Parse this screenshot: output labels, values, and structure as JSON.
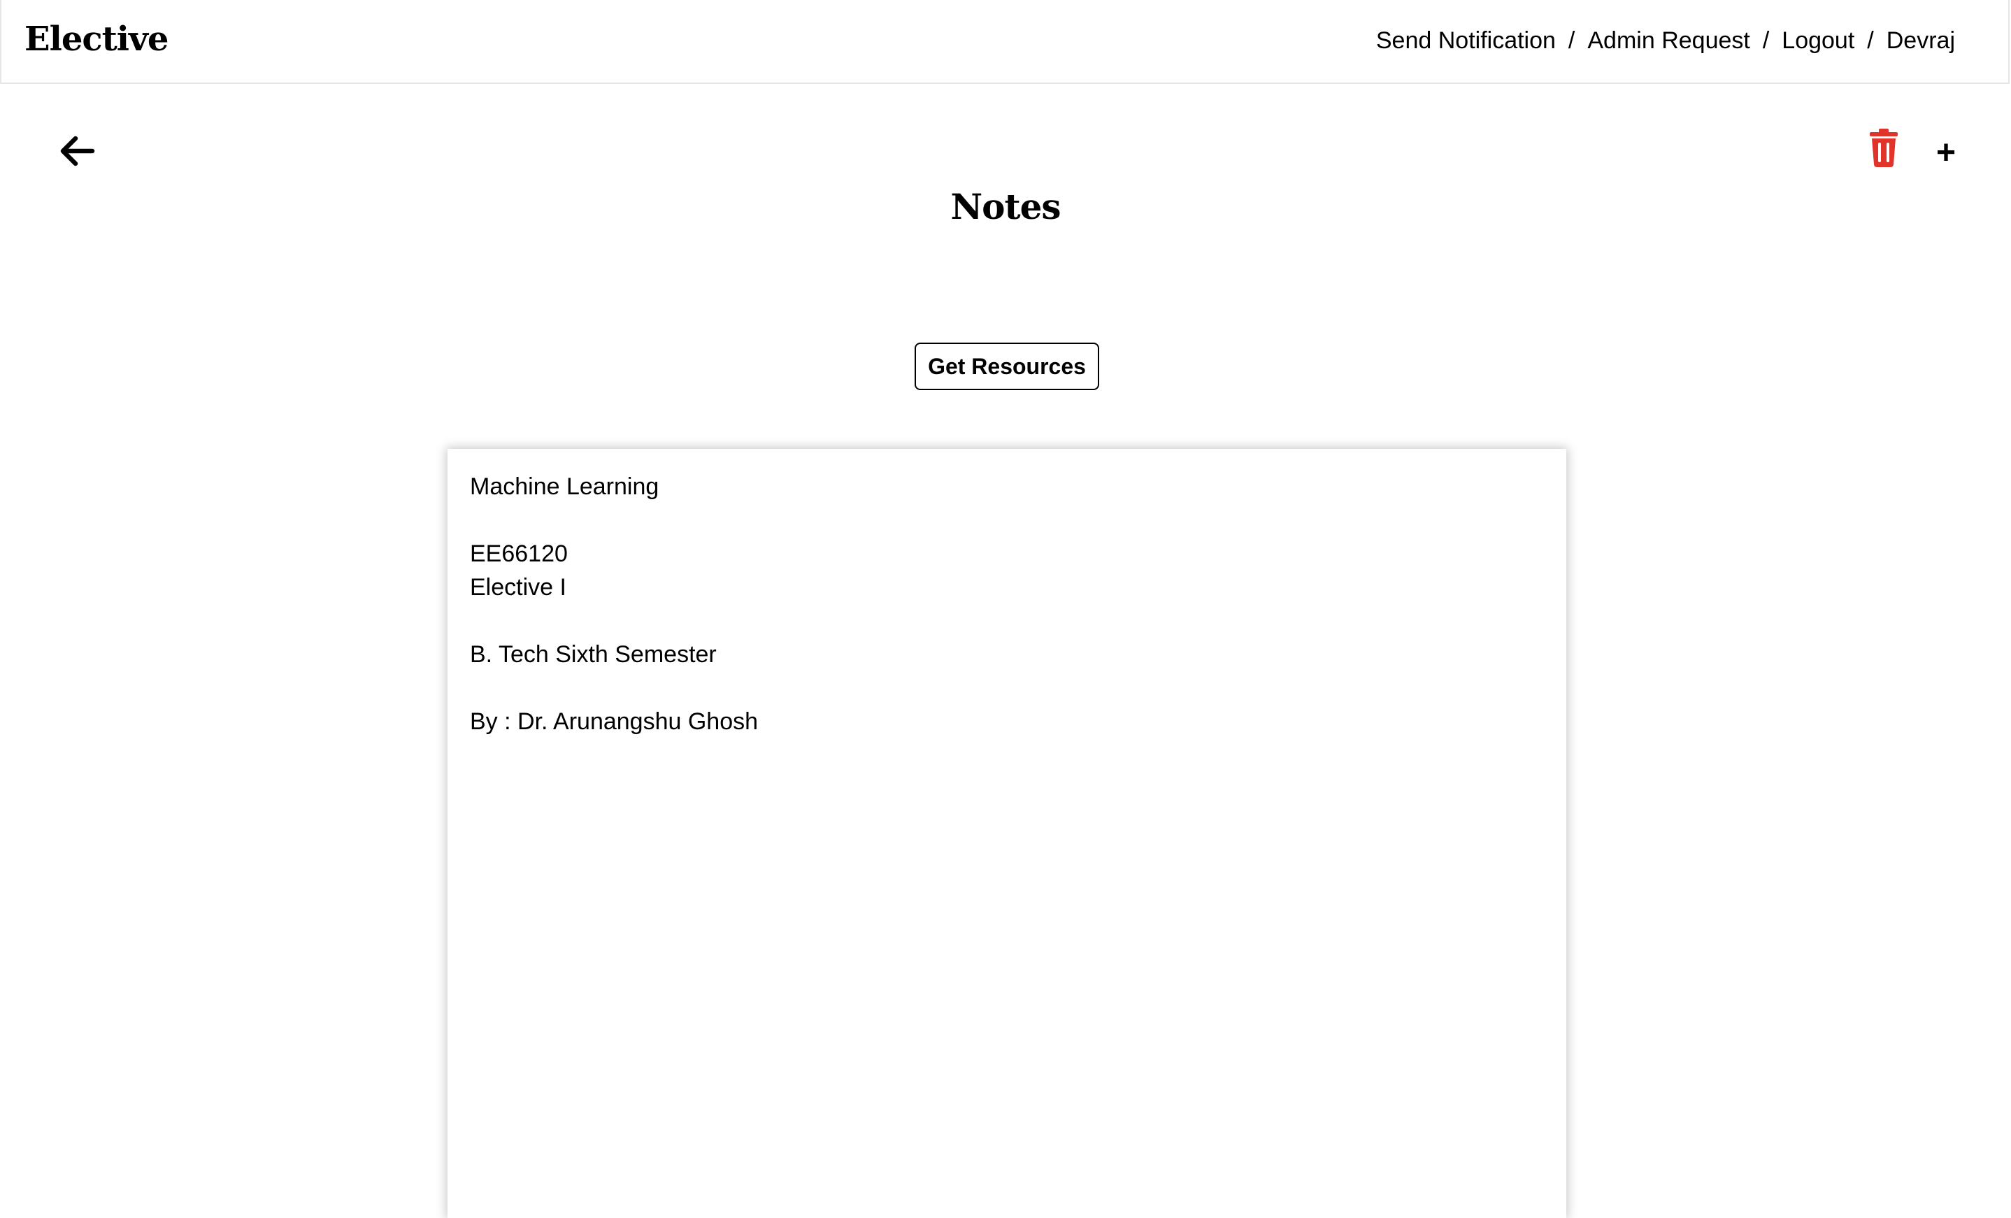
{
  "navbar": {
    "brand": "Elective",
    "links": [
      "Send Notification",
      "Admin Request",
      "Logout",
      "Devraj"
    ],
    "separator": "/"
  },
  "toolbar": {
    "back_icon": "arrow-left-icon",
    "trash_icon": "trash-icon",
    "trash_color": "#e0342b",
    "add_icon": "plus-icon",
    "add_label": "+"
  },
  "page": {
    "title": "Notes",
    "resources_button": "Get Resources"
  },
  "document": {
    "course_name": "Machine Learning",
    "course_code": "EE66120",
    "elective": "Elective I",
    "program": "B. Tech Sixth Semester",
    "author": "By : Dr. Arunangshu Ghosh"
  }
}
